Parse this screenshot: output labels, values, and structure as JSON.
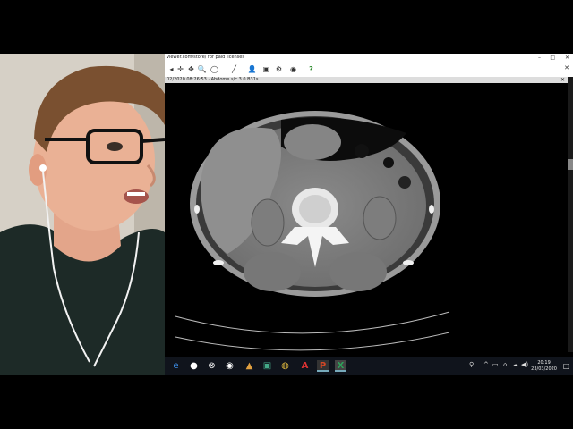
{
  "browser": {
    "url": "viewer.com/store/ for paid licenses",
    "minimize": "–",
    "maximize": "□",
    "close": "✕"
  },
  "toolbar": {
    "close": "✕",
    "tools": [
      {
        "icon": "crosshair-icon",
        "glyph": "✛"
      },
      {
        "icon": "pan-icon",
        "glyph": "✥"
      },
      {
        "icon": "zoom-icon",
        "glyph": "🔍"
      },
      {
        "icon": "window-level-icon",
        "glyph": "◯"
      },
      {
        "icon": "measure-icon",
        "glyph": "╱"
      },
      {
        "icon": "person-icon",
        "glyph": "👤"
      },
      {
        "icon": "screen-icon",
        "glyph": "▣"
      },
      {
        "icon": "settings-icon",
        "glyph": "⚙"
      },
      {
        "icon": "globe-icon",
        "glyph": "◉"
      },
      {
        "icon": "help-icon",
        "glyph": "?"
      }
    ]
  },
  "viewer": {
    "series_label": "02/2020 08:26:53 · Abdome s/c 3.0 B31s",
    "close": "✕"
  },
  "taskbar": {
    "icons": [
      {
        "name": "edge-icon",
        "glyph": "e",
        "color": "#3d8ee8"
      },
      {
        "name": "steam-icon",
        "glyph": "●",
        "color": "#ddd"
      },
      {
        "name": "xbox-icon",
        "glyph": "⊗",
        "color": "#ddd"
      },
      {
        "name": "obs-icon",
        "glyph": "◉",
        "color": "#ddd"
      },
      {
        "name": "paint-icon",
        "glyph": "▲",
        "color": "#e0a040"
      },
      {
        "name": "image-viewer-icon",
        "glyph": "▣",
        "color": "#4a8"
      },
      {
        "name": "chrome-icon",
        "glyph": "◍",
        "color": "#e8c040"
      },
      {
        "name": "acrobat-icon",
        "glyph": "A",
        "color": "#d33"
      },
      {
        "name": "powerpoint-icon",
        "glyph": "P",
        "color": "#d24726"
      },
      {
        "name": "excel-icon",
        "glyph": "X",
        "color": "#1e7145"
      }
    ],
    "time": "20:19",
    "date": "23/03/2020"
  }
}
